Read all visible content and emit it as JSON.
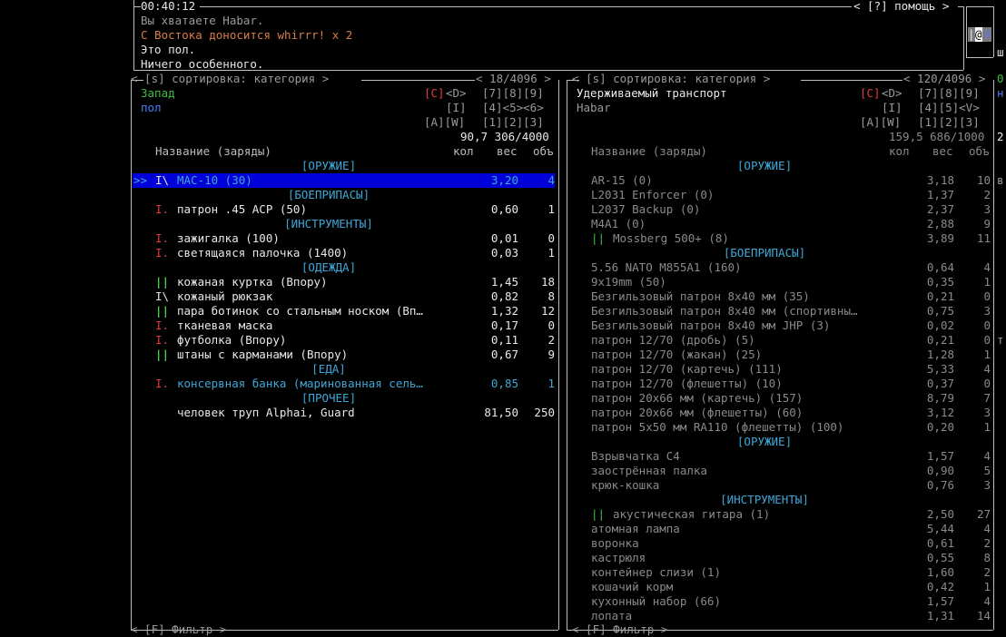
{
  "top": {
    "time": "00:40:12",
    "help": "< [?] помощь >",
    "messages": [
      {
        "text": "Вы хватаете Habar.",
        "color": "g"
      },
      {
        "text": "С Востока доносится whirrr! x 2",
        "color": "br"
      },
      {
        "text": "Это пол.",
        "color": "w"
      },
      {
        "text": "Ничего особенного.",
        "color": "w"
      }
    ],
    "minimap_glyph": "@",
    "minimap_left": "|",
    "minimap_right": "V",
    "side_char": "ш"
  },
  "left": {
    "sort_label": "< [s] сортировка: категория >",
    "count": "< 18/4096 >",
    "location": "Запад",
    "sublocation": "пол",
    "dir_row1": [
      "[C]",
      "<D>",
      "[7][8][9]"
    ],
    "dir_row2": [
      "[I]",
      "[4]<5><6>"
    ],
    "dir_row3": [
      "[A][W]",
      "[1][2][3]"
    ],
    "totals": "90,7 306/4000",
    "headers": {
      "name": "Название (заряды)",
      "qty": "кол",
      "wt": "вес",
      "vol": "объ"
    },
    "filter": "< [F] Фильтр >",
    "rows": [
      {
        "type": "cat",
        "text": "[ОРУЖИЕ]"
      },
      {
        "type": "item",
        "cursor": ">>",
        "mark": "I\\",
        "markColor": "w",
        "name": "MAC-10 (30)",
        "qty": "",
        "wt": "3,20",
        "vol": "4",
        "selected": true,
        "color": "cy"
      },
      {
        "type": "cat",
        "text": "[БОЕПРИПАСЫ]"
      },
      {
        "type": "item",
        "mark": "I.",
        "markColor": "rd",
        "name": "патрон .45 ACP (50)",
        "qty": "",
        "wt": "0,60",
        "vol": "1",
        "color": "w"
      },
      {
        "type": "cat",
        "text": "[ИНСТРУМЕНТЫ]"
      },
      {
        "type": "item",
        "mark": "I.",
        "markColor": "rd",
        "name": "зажигалка (100)",
        "qty": "",
        "wt": "0,01",
        "vol": "0",
        "color": "w"
      },
      {
        "type": "item",
        "mark": "I.",
        "markColor": "rd",
        "name": "светящаяся палочка (1400)",
        "qty": "",
        "wt": "0,03",
        "vol": "1",
        "color": "w"
      },
      {
        "type": "cat",
        "text": "[ОДЕЖДА]"
      },
      {
        "type": "item",
        "mark": "||",
        "markColor": "bgr",
        "name": "кожаная куртка (Впору)",
        "qty": "",
        "wt": "1,45",
        "vol": "18",
        "color": "w"
      },
      {
        "type": "item",
        "mark": "I\\",
        "markColor": "w",
        "name": "кожаный рюкзак",
        "qty": "",
        "wt": "0,82",
        "vol": "8",
        "color": "w"
      },
      {
        "type": "item",
        "mark": "||",
        "markColor": "bgr",
        "name": "пара ботинок со стальным носком (Вп…",
        "qty": "",
        "wt": "1,32",
        "vol": "12",
        "color": "w"
      },
      {
        "type": "item",
        "mark": "I.",
        "markColor": "rd",
        "name": "тканевая маска",
        "qty": "",
        "wt": "0,17",
        "vol": "0",
        "color": "w"
      },
      {
        "type": "item",
        "mark": "I.",
        "markColor": "rd",
        "name": "футболка (Впору)",
        "qty": "",
        "wt": "0,11",
        "vol": "2",
        "color": "w"
      },
      {
        "type": "item",
        "mark": "||",
        "markColor": "bgr",
        "name": "штаны с карманами (Впору)",
        "qty": "",
        "wt": "0,67",
        "vol": "9",
        "color": "w"
      },
      {
        "type": "cat",
        "text": "[ЕДА]"
      },
      {
        "type": "item",
        "mark": "I.",
        "markColor": "rd",
        "name": "консервная банка (маринованная сель…",
        "qty": "",
        "wt": "0,85",
        "vol": "1",
        "color": "cy"
      },
      {
        "type": "cat",
        "text": "[ПРОЧЕЕ]"
      },
      {
        "type": "item",
        "mark": "",
        "markColor": "w",
        "name": "человек труп Alphai, Guard",
        "qty": "",
        "wt": "81,50",
        "vol": "250",
        "color": "w"
      }
    ]
  },
  "right": {
    "sort_label": "< [s] сортировка: категория >",
    "count": "< 120/4096 >",
    "location": "Удерживаемый транспорт",
    "sublocation": "Habar",
    "dir_row1": [
      "[C]",
      "<D>",
      "[7][8][9]"
    ],
    "dir_row2": [
      "[I]",
      "[4][5]<V>"
    ],
    "dir_row3": [
      "[A][W]",
      "[1][2][3]"
    ],
    "totals": "159,5 686/1000",
    "headers": {
      "name": "Название (заряды)",
      "qty": "кол",
      "wt": "вес",
      "vol": "объ"
    },
    "filter": "< [F] Фильтр >",
    "edge_chars": [
      "0",
      "н",
      "2",
      "в",
      "т"
    ],
    "rows": [
      {
        "type": "cat",
        "text": "[ОРУЖИЕ]"
      },
      {
        "type": "item",
        "mark": "",
        "name": "AR-15 (0)",
        "wt": "3,18",
        "vol": "10",
        "color": "dg"
      },
      {
        "type": "item",
        "mark": "",
        "name": "L2031 Enforcer (0)",
        "wt": "1,37",
        "vol": "2",
        "color": "dg"
      },
      {
        "type": "item",
        "mark": "",
        "name": "L2037 Backup (0)",
        "wt": "2,37",
        "vol": "3",
        "color": "dg"
      },
      {
        "type": "item",
        "mark": "",
        "name": "M4A1 (0)",
        "wt": "2,88",
        "vol": "9",
        "color": "dg"
      },
      {
        "type": "item",
        "mark": "||",
        "markColor": "gr",
        "name": "Mossberg 500+ (8)",
        "wt": "3,89",
        "vol": "11",
        "color": "dg"
      },
      {
        "type": "cat",
        "text": "[БОЕПРИПАСЫ]"
      },
      {
        "type": "item",
        "mark": "",
        "name": "5.56 NATO M855A1 (160)",
        "wt": "0,64",
        "vol": "4",
        "color": "dg"
      },
      {
        "type": "item",
        "mark": "",
        "name": "9x19mm (50)",
        "wt": "0,35",
        "vol": "1",
        "color": "dg"
      },
      {
        "type": "item",
        "mark": "",
        "name": "Безгильзовый патрон 8x40 мм (35)",
        "wt": "0,21",
        "vol": "0",
        "color": "dg"
      },
      {
        "type": "item",
        "mark": "",
        "name": "Безгильзовый патрон 8x40 мм (спортивны…",
        "wt": "0,75",
        "vol": "3",
        "color": "dg"
      },
      {
        "type": "item",
        "mark": "",
        "name": "Безгильзовый патрон 8x40 мм JHP (3)",
        "wt": "0,02",
        "vol": "0",
        "color": "dg"
      },
      {
        "type": "item",
        "mark": "",
        "name": "патрон 12/70 (дробь) (5)",
        "wt": "0,21",
        "vol": "0",
        "color": "dg"
      },
      {
        "type": "item",
        "mark": "",
        "name": "патрон 12/70 (жакан) (25)",
        "wt": "1,28",
        "vol": "1",
        "color": "dg"
      },
      {
        "type": "item",
        "mark": "",
        "name": "патрон 12/70 (картечь) (111)",
        "wt": "5,33",
        "vol": "4",
        "color": "dg"
      },
      {
        "type": "item",
        "mark": "",
        "name": "патрон 12/70 (флешетты) (10)",
        "wt": "0,37",
        "vol": "0",
        "color": "dg"
      },
      {
        "type": "item",
        "mark": "",
        "name": "патрон 20x66 мм (картечь) (157)",
        "wt": "8,79",
        "vol": "7",
        "color": "dg"
      },
      {
        "type": "item",
        "mark": "",
        "name": "патрон 20x66 мм (флешетты) (60)",
        "wt": "3,12",
        "vol": "3",
        "color": "dg"
      },
      {
        "type": "item",
        "mark": "",
        "name": "патрон 5x50 мм RA110 (флешетты) (100)",
        "wt": "0,20",
        "vol": "1",
        "color": "dg"
      },
      {
        "type": "cat",
        "text": "[ОРУЖИЕ]"
      },
      {
        "type": "item",
        "mark": "",
        "name": "Взрывчатка C4",
        "wt": "1,57",
        "vol": "4",
        "color": "dg"
      },
      {
        "type": "item",
        "mark": "",
        "name": "заострённая палка",
        "wt": "0,90",
        "vol": "5",
        "color": "dg"
      },
      {
        "type": "item",
        "mark": "",
        "name": "крюк-кошка",
        "wt": "0,76",
        "vol": "3",
        "color": "dg"
      },
      {
        "type": "cat",
        "text": "[ИНСТРУМЕНТЫ]"
      },
      {
        "type": "item",
        "mark": "||",
        "markColor": "gr",
        "name": "акустическая гитара (1)",
        "wt": "2,50",
        "vol": "27",
        "color": "dg"
      },
      {
        "type": "item",
        "mark": "",
        "name": "атомная лампа",
        "wt": "5,44",
        "vol": "4",
        "color": "dg"
      },
      {
        "type": "item",
        "mark": "",
        "name": "воронка",
        "wt": "0,61",
        "vol": "2",
        "color": "dg"
      },
      {
        "type": "item",
        "mark": "",
        "name": "кастрюля",
        "wt": "0,55",
        "vol": "8",
        "color": "dg"
      },
      {
        "type": "item",
        "mark": "",
        "name": "контейнер слизи (1)",
        "wt": "1,60",
        "vol": "2",
        "color": "dg"
      },
      {
        "type": "item",
        "mark": "",
        "name": "кошачий корм",
        "wt": "0,42",
        "vol": "1",
        "color": "dg"
      },
      {
        "type": "item",
        "mark": "",
        "name": "кухонный набор (66)",
        "wt": "1,57",
        "vol": "4",
        "color": "dg"
      },
      {
        "type": "item",
        "mark": "",
        "name": "лопата",
        "wt": "1,31",
        "vol": "14",
        "color": "dg"
      }
    ]
  }
}
